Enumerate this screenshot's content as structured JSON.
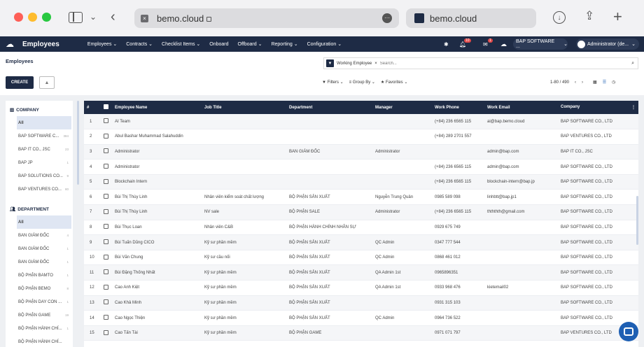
{
  "browser": {
    "url": "bemo.cloud",
    "tab_title": "bemo.cloud"
  },
  "appnav": {
    "app_title": "Employees",
    "menu": [
      "Employees ⌄",
      "Contracts ⌄",
      "Checklist Items ⌄",
      "Onboard",
      "Offboard ⌄",
      "Reporting ⌄",
      "Configuration ⌄"
    ],
    "badge_activity": "10",
    "badge_messages": "1",
    "company_switch": "BAP SOFTWARE ...",
    "user": "Administrator (de..."
  },
  "subbar": {
    "breadcrumb": "Employees",
    "create_label": "CREATE",
    "facet_label": "Working Employee",
    "search_placeholder": "Search...",
    "filters_label": "Filters",
    "groupby_label": "Group By",
    "favorites_label": "Favorites",
    "pager": "1-80 / 490"
  },
  "sidebar": {
    "company_head": "COMPANY",
    "companies": [
      {
        "label": "All",
        "count": ""
      },
      {
        "label": "BAP SOFTWARE C...",
        "count": "384"
      },
      {
        "label": "BAP IT CO., JSC",
        "count": "23"
      },
      {
        "label": "BAP JP",
        "count": "1"
      },
      {
        "label": "BAP SOLUTIONS CO...",
        "count": "9"
      },
      {
        "label": "BAP VENTURES CO...",
        "count": "80"
      }
    ],
    "dept_head": "DEPARTMENT",
    "departments": [
      {
        "label": "All",
        "count": ""
      },
      {
        "label": "BAN GIÁM ĐỐC",
        "count": "4"
      },
      {
        "label": "BAN GIÁM ĐỐC",
        "count": "1"
      },
      {
        "label": "BAN GIÁM ĐỐC",
        "count": "1"
      },
      {
        "label": "BỘ PHẬN BAMTO",
        "count": "1"
      },
      {
        "label": "BỘ PHẬN BEMO",
        "count": "8"
      },
      {
        "label": "BỘ PHẬN DAY CON ...",
        "count": "1"
      },
      {
        "label": "BỘ PHẬN GAME",
        "count": "19"
      },
      {
        "label": "BỘ PHẬN HÀNH CHÍ...",
        "count": "1"
      },
      {
        "label": "BỘ PHẬN HÀNH CHÍ...",
        "count": ""
      }
    ]
  },
  "table": {
    "headers": [
      "#",
      "",
      "Employee Name",
      "Job Title",
      "Department",
      "Manager",
      "Work Phone",
      "Work Email",
      "Company"
    ],
    "rows": [
      [
        "1",
        "AI Team",
        "",
        "",
        "",
        "(+84) 236 6565 115",
        "ai@bap.bemo.cloud",
        "BAP SOFTWARE CO., LTD"
      ],
      [
        "2",
        "Abul Bashar Muhammad Salahuddin",
        "",
        "",
        "",
        "(+84) 289 2701 557",
        "",
        "BAP VENTURES CO., LTD"
      ],
      [
        "3",
        "Administrator",
        "",
        "BAN GIÁM ĐỐC",
        "Administrator",
        "",
        "admin@bap.com",
        "BAP IT CO., JSC"
      ],
      [
        "4",
        "Administrator",
        "",
        "",
        "",
        "(+84) 236 6565 115",
        "admin@bap.com",
        "BAP SOFTWARE CO., LTD"
      ],
      [
        "5",
        "Blockchain Intern",
        "",
        "",
        "",
        "(+84) 236 6565 115",
        "blockchain-intern@bap.jp",
        "BAP SOFTWARE CO., LTD"
      ],
      [
        "6",
        "Bùi Thị Thùy Linh",
        "Nhân viên kiểm soát chất lượng",
        "BỘ PHẬN SẢN XUẤT",
        "Nguyễn Trung Quân",
        "0985 589 098",
        "linhbtt@bap.jp1",
        "BAP SOFTWARE CO., LTD"
      ],
      [
        "7",
        "Bùi Thị Thùy Linh",
        "NV sale",
        "BỘ PHẬN SALE",
        "Administrator",
        "(+84) 236 6565 115",
        "thththth@gmail.com",
        "BAP SOFTWARE CO., LTD"
      ],
      [
        "8",
        "Bùi Thục Loan",
        "Nhân viên C&B",
        "BỘ PHẬN HÀNH CHÍNH NHÂN SỰ",
        "",
        "0929 675 749",
        "",
        "BAP SOFTWARE CO., LTD"
      ],
      [
        "9",
        "Bùi Tuấn Dũng CICO",
        "Kỹ sư phần mềm",
        "BỘ PHẬN SẢN XUẤT",
        "QC Admin",
        "0347 777 544",
        "",
        "BAP SOFTWARE CO., LTD"
      ],
      [
        "10",
        "Bùi Văn Chung",
        "Kỹ sư cầu nối",
        "BỘ PHẬN SẢN XUẤT",
        "QC Admin",
        "0868 461 012",
        "",
        "BAP SOFTWARE CO., LTD"
      ],
      [
        "11",
        "Bùi Đặng Thống Nhất",
        "Kỹ sư phần mềm",
        "BỘ PHẬN SẢN XUẤT",
        "QA Admin 1st",
        "0965896351",
        "",
        "BAP SOFTWARE CO., LTD"
      ],
      [
        "12",
        "Cao Anh Kiệt",
        "Kỹ sư phần mềm",
        "BỘ PHẬN SẢN XUẤT",
        "QA Admin 1st",
        "0933 968 476",
        "kietemail02",
        "BAP SOFTWARE CO., LTD"
      ],
      [
        "13",
        "Cao Khả Minh",
        "Kỹ sư phần mềm",
        "BỘ PHẬN SẢN XUẤT",
        "",
        "0931 315 103",
        "",
        "BAP SOFTWARE CO., LTD"
      ],
      [
        "14",
        "Cao Ngọc Thiện",
        "Kỹ sư phần mềm",
        "BỘ PHẬN SẢN XUẤT",
        "QC Admin",
        "0964 736 522",
        "",
        "BAP SOFTWARE CO., LTD"
      ],
      [
        "15",
        "Cao Tấn Tài",
        "Kỹ sư phần mềm",
        "BỘ PHẬN GAME",
        "",
        "0971 071 797",
        "",
        "BAP VENTURES CO., LTD"
      ]
    ]
  },
  "colors": {
    "nav_bg": "#1e2b45",
    "accent": "#1e5fb3",
    "badge": "#e04848"
  }
}
